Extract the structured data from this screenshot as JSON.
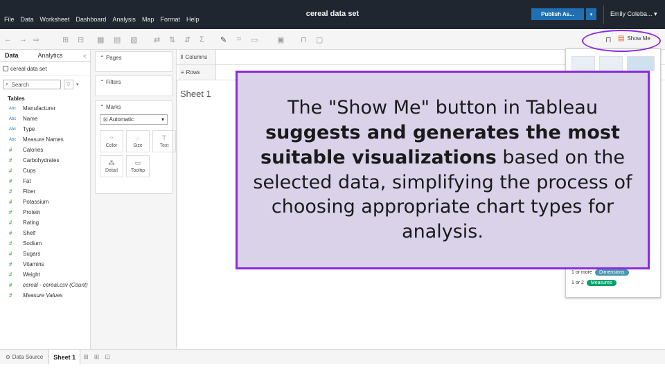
{
  "window": {
    "title": "cereal data set",
    "menu": [
      "File",
      "Data",
      "Worksheet",
      "Dashboard",
      "Analysis",
      "Map",
      "Format",
      "Help"
    ],
    "publish_label": "Publish As...",
    "publish_caret": "▾",
    "user": "Emily Coleba... ▾"
  },
  "toolbar": {
    "show_me_label": "Show Me"
  },
  "data_pane": {
    "tabs": [
      "Data",
      "Analytics"
    ],
    "collapse": "<",
    "source": "cereal data set",
    "search_placeholder": "Search",
    "tables_header": "Tables",
    "fields": [
      {
        "type": "Abc",
        "name": "Manufacturer"
      },
      {
        "type": "Abc",
        "name": "Name"
      },
      {
        "type": "Abc",
        "name": "Type"
      },
      {
        "type": "Abc",
        "name": "Measure Names"
      },
      {
        "type": "#",
        "name": "Calories"
      },
      {
        "type": "#",
        "name": "Carbohydrates"
      },
      {
        "type": "#",
        "name": "Cups"
      },
      {
        "type": "#",
        "name": "Fat"
      },
      {
        "type": "#",
        "name": "Fiber"
      },
      {
        "type": "#",
        "name": "Potassium"
      },
      {
        "type": "#",
        "name": "Protein"
      },
      {
        "type": "#",
        "name": "Rating"
      },
      {
        "type": "#",
        "name": "Shelf"
      },
      {
        "type": "#",
        "name": "Sodium"
      },
      {
        "type": "#",
        "name": "Sugars"
      },
      {
        "type": "#",
        "name": "Vitamins"
      },
      {
        "type": "#",
        "name": "Weight"
      },
      {
        "type": "#",
        "name": "cereal - cereal.csv (Count)",
        "italic": true
      },
      {
        "type": "#",
        "name": "Measure Values",
        "italic": true
      }
    ]
  },
  "shelves": {
    "pages": "Pages",
    "filters": "Filters",
    "marks": "Marks",
    "mark_type": "Automatic",
    "mark_buttons": [
      "Color",
      "Size",
      "Text",
      "Detail",
      "Tooltip"
    ],
    "columns": "Columns",
    "rows": "Rows"
  },
  "sheet": {
    "title": "Sheet 1"
  },
  "show_me_panel": {
    "req1_prefix": "1 or more",
    "req1_pill": "Dimensions",
    "req2_prefix": "1 or 2",
    "req2_pill": "Measures"
  },
  "bottom_bar": {
    "data_source": "Data Source",
    "sheet_tab": "Sheet 1"
  },
  "callout": {
    "part1": "The \"Show  Me\" button in Tableau ",
    "bold": "suggests and generates the most suitable visualizations",
    "part2": " based on the selected data, simplifying the process of choosing appropriate chart types for analysis."
  },
  "colors": {
    "accent": "#8a2be2",
    "callout_bg": "#d9d2e9",
    "publish": "#1f6fb2",
    "dimension_pill": "#4996b2",
    "measure_pill": "#00a36c"
  }
}
